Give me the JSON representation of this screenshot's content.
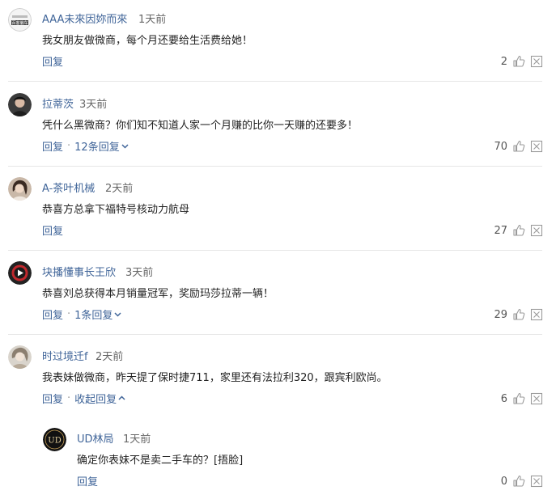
{
  "comments": [
    {
      "username": "AAA未來因妳而來",
      "time": "1天前",
      "text": "我女朋友做微商，每个月还要给生活费给她！",
      "reply_label": "回复",
      "more_label": "",
      "likes": "2",
      "avatar": "avatar-badge-logo",
      "avatar_text": "百客偏车"
    },
    {
      "username": "拉蒂茨",
      "time": "3天前",
      "text": "凭什么黑微商？你们知不知道人家一个月赚的比你一天赚的还要多！",
      "reply_label": "回复",
      "more_label": "12条回复",
      "likes": "70",
      "avatar": "avatar-person-dark"
    },
    {
      "username": "A-茶叶机械",
      "time": "2天前",
      "text": "恭喜方总拿下福特号核动力航母",
      "reply_label": "回复",
      "more_label": "",
      "likes": "27",
      "avatar": "avatar-person-woman"
    },
    {
      "username": "块播懂事长王欣",
      "time": "3天前",
      "text": "恭喜刘总获得本月销量冠军，奖励玛莎拉蒂一辆！",
      "reply_label": "回复",
      "more_label": "1条回复",
      "likes": "29",
      "avatar": "avatar-play-logo"
    },
    {
      "username": "时过境迁f",
      "time": "2天前",
      "text": "我表妹做微商，昨天提了保时捷711，家里还有法拉利320，跟宾利欧尚。",
      "reply_label": "回复",
      "more_label": "收起回复",
      "likes": "6",
      "avatar": "avatar-person-light"
    }
  ],
  "reply": {
    "username": "UD林局",
    "time": "1天前",
    "text": "确定你表妹不是卖二手车的？[捂脸]",
    "reply_label": "回复",
    "likes": "0",
    "avatar": "avatar-ud-logo",
    "avatar_text": "UD"
  },
  "colors": {
    "link": "#406599",
    "text": "#222222",
    "muted": "#666666",
    "icon": "#9a9a9a",
    "divider": "#e6e6e6"
  },
  "icons": [
    "thumbs-up-icon",
    "report-icon",
    "chevron-down-icon",
    "chevron-up-icon"
  ]
}
